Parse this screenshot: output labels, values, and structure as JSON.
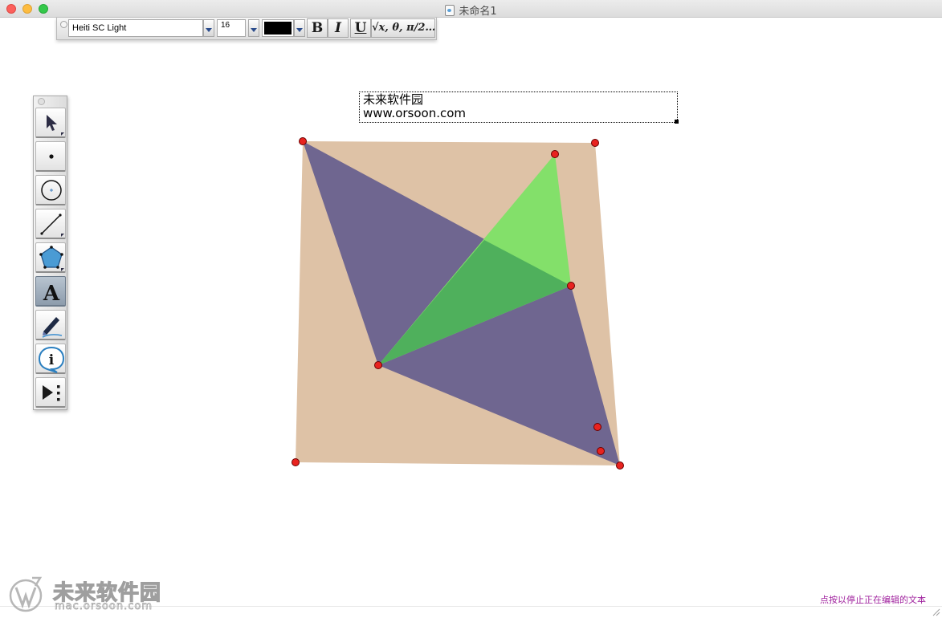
{
  "window": {
    "title": "未命名1",
    "controls": [
      "close-icon",
      "minimize-icon",
      "zoom-icon"
    ]
  },
  "text_toolbar": {
    "font_name": "Heiti SC Light",
    "font_size": "16",
    "text_color": "#000000",
    "bold_label": "B",
    "italic_label": "I",
    "underline_label": "U",
    "math_label": "√x, θ, π/2…"
  },
  "tool_palette": {
    "tools": [
      {
        "name": "arrow-tool",
        "icon": "arrow-pointer-icon"
      },
      {
        "name": "point-tool",
        "icon": "point-icon"
      },
      {
        "name": "compass-tool",
        "icon": "circle-icon"
      },
      {
        "name": "straightedge-tool",
        "icon": "line-segment-icon"
      },
      {
        "name": "polygon-tool",
        "icon": "pentagon-icon"
      },
      {
        "name": "text-tool",
        "icon": "letter-a-icon",
        "label": "A",
        "active": true
      },
      {
        "name": "marker-tool",
        "icon": "marker-pen-icon"
      },
      {
        "name": "information-tool",
        "icon": "info-icon",
        "label": "i"
      },
      {
        "name": "custom-tool",
        "icon": "play-more-icon"
      }
    ]
  },
  "canvas_text": {
    "line1": "未来软件园",
    "line2": "www.orsoon.com"
  },
  "figure": {
    "colors": {
      "quad": "#dec2a6",
      "purple": "#6f6690",
      "green": "#83e06a",
      "overlap": "#4fb05c",
      "point": "#e8231f"
    }
  },
  "status": {
    "message": "点按以停止正在编辑的文本"
  },
  "watermark": {
    "title": "未来软件园",
    "url": "mac.orsoon.com"
  }
}
